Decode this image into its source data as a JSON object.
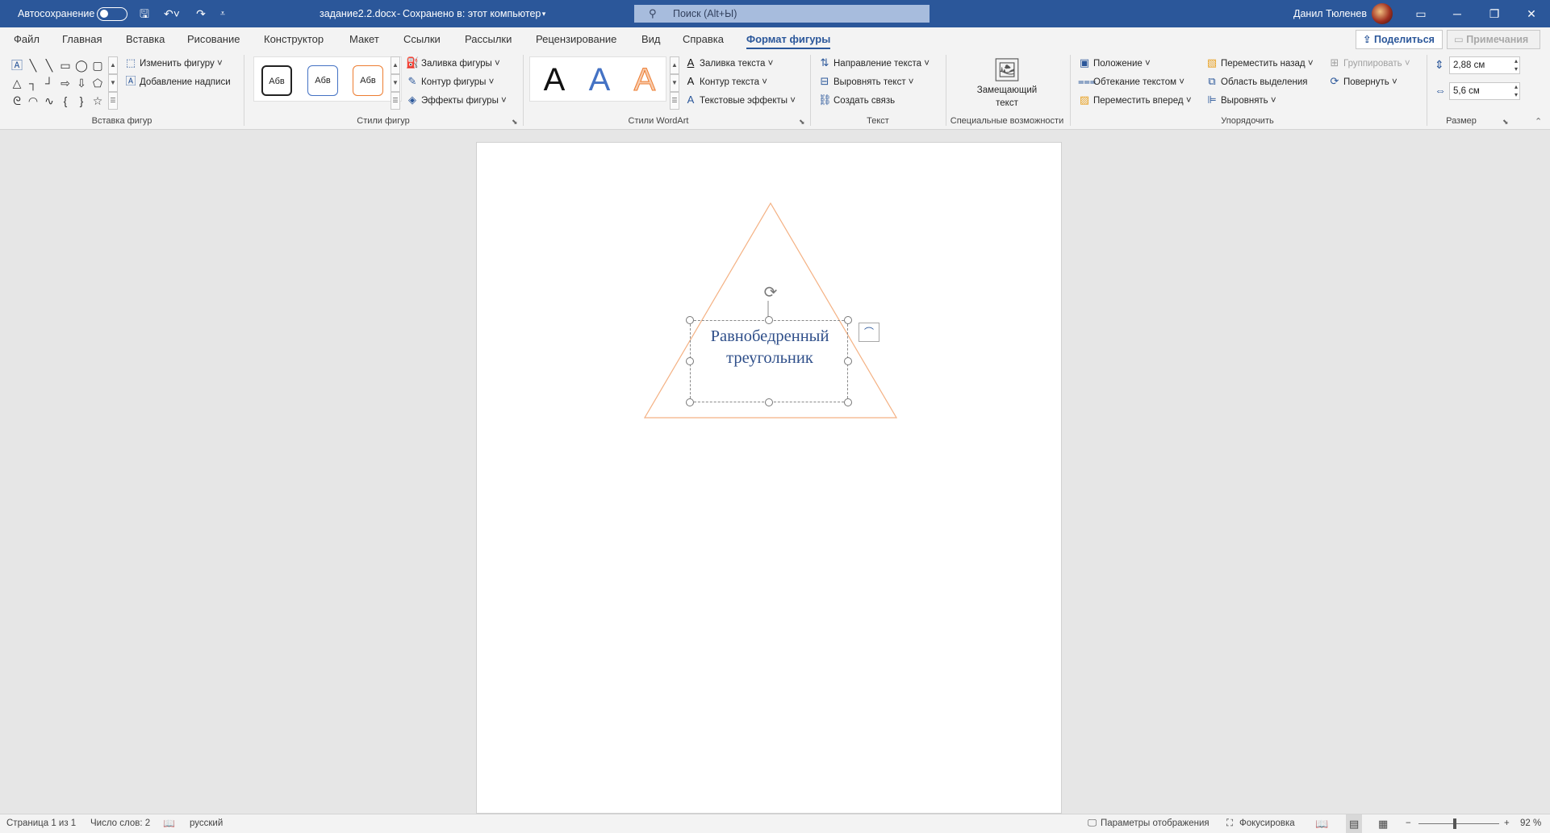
{
  "titlebar": {
    "autosave_label": "Автосохранение",
    "doc_title": "задание2.2.docx",
    "save_status": "Сохранено в: этот компьютер",
    "search_placeholder": "Поиск (Alt+Ы)",
    "user_name": "Данил Тюленев",
    "icons": [
      "save-icon",
      "undo-icon",
      "redo-icon",
      "customize-qat-icon",
      "search-icon",
      "ribbon-display-icon",
      "minimize-icon",
      "restore-icon",
      "close-icon"
    ]
  },
  "tabs": [
    {
      "label": "Файл"
    },
    {
      "label": "Главная"
    },
    {
      "label": "Вставка"
    },
    {
      "label": "Рисование"
    },
    {
      "label": "Конструктор"
    },
    {
      "label": "Макет"
    },
    {
      "label": "Ссылки"
    },
    {
      "label": "Рассылки"
    },
    {
      "label": "Рецензирование"
    },
    {
      "label": "Вид"
    },
    {
      "label": "Справка"
    },
    {
      "label": "Формат фигуры",
      "active": true
    }
  ],
  "share_label": "Поделиться",
  "comments_label": "Примечания",
  "ribbon": {
    "insert_shapes": {
      "label": "Вставка фигур",
      "edit_shape": "Изменить фигуру",
      "add_text": "Добавление надписи"
    },
    "shape_styles": {
      "label": "Стили фигур",
      "swatch_text": "Абв",
      "fill": "Заливка фигуры",
      "outline": "Контур фигуры",
      "effects": "Эффекты фигуры"
    },
    "wordart": {
      "label": "Стили WordArt",
      "letter": "A",
      "text_fill": "Заливка текста",
      "text_outline": "Контур текста",
      "text_effects": "Текстовые эффекты"
    },
    "text": {
      "label": "Текст",
      "direction": "Направление текста",
      "align": "Выровнять текст",
      "link": "Создать связь"
    },
    "accessibility": {
      "label": "Специальные возможности",
      "alt_text_line1": "Замещающий",
      "alt_text_line2": "текст"
    },
    "arrange": {
      "label": "Упорядочить",
      "position": "Положение",
      "wrap": "Обтекание текстом",
      "forward": "Переместить вперед",
      "backward": "Переместить назад",
      "selection_pane": "Область выделения",
      "align": "Выровнять",
      "group": "Группировать",
      "rotate": "Повернуть"
    },
    "size": {
      "label": "Размер",
      "height": "2,88 см",
      "width": "5,6 см"
    }
  },
  "document": {
    "textbox_line1": "Равнобедренный",
    "textbox_line2": "треугольник",
    "triangle_outline_color": "#f4b183",
    "text_color": "#2f4f8a"
  },
  "statusbar": {
    "page": "Страница 1 из 1",
    "words": "Число слов: 2",
    "language": "русский",
    "display_settings": "Параметры отображения",
    "focus": "Фокусировка",
    "zoom": "92 %"
  },
  "colors": {
    "accent": "#2b579a"
  }
}
